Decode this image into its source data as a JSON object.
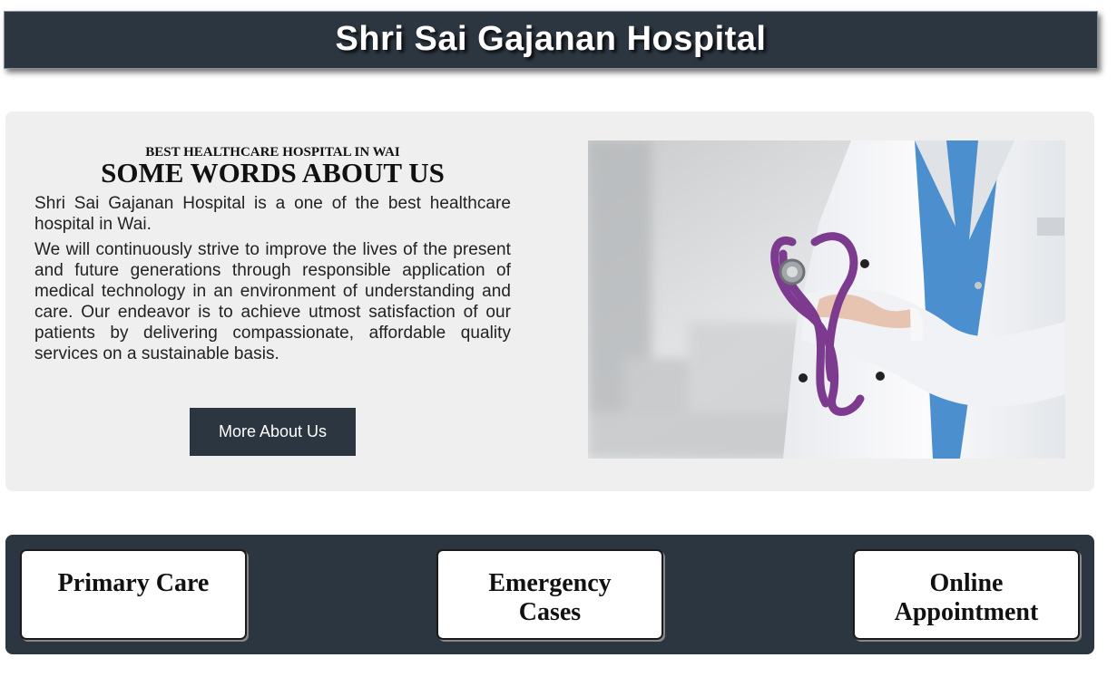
{
  "header": {
    "title": "Shri Sai Gajanan Hospital"
  },
  "about": {
    "kicker": "BEST HEALTHCARE HOSPITAL IN WAI",
    "title": "SOME WORDS ABOUT US",
    "paragraph_1": "Shri Sai Gajanan Hospital is a one of the best healthcare hospital in Wai.",
    "paragraph_2": "We will continuously strive to improve the lives of the present and future generations through responsible application of medical technology in an environment of understanding and care. Our endeavor is to achieve utmost satisfaction of our patients by delivering compassionate, affordable quality services on a sustainable basis.",
    "button_label": "More About Us"
  },
  "services": {
    "cards": [
      {
        "label": "Primary Care"
      },
      {
        "label": "Emergency Cases"
      },
      {
        "label": "Online Appointment"
      }
    ]
  },
  "colors": {
    "dark_navy": "#2c3640",
    "panel_gray": "#efefef",
    "coat_white": "#f4f5f7",
    "scrubs_blue": "#4b8fcf",
    "stethoscope_purple": "#7d3b8f"
  }
}
